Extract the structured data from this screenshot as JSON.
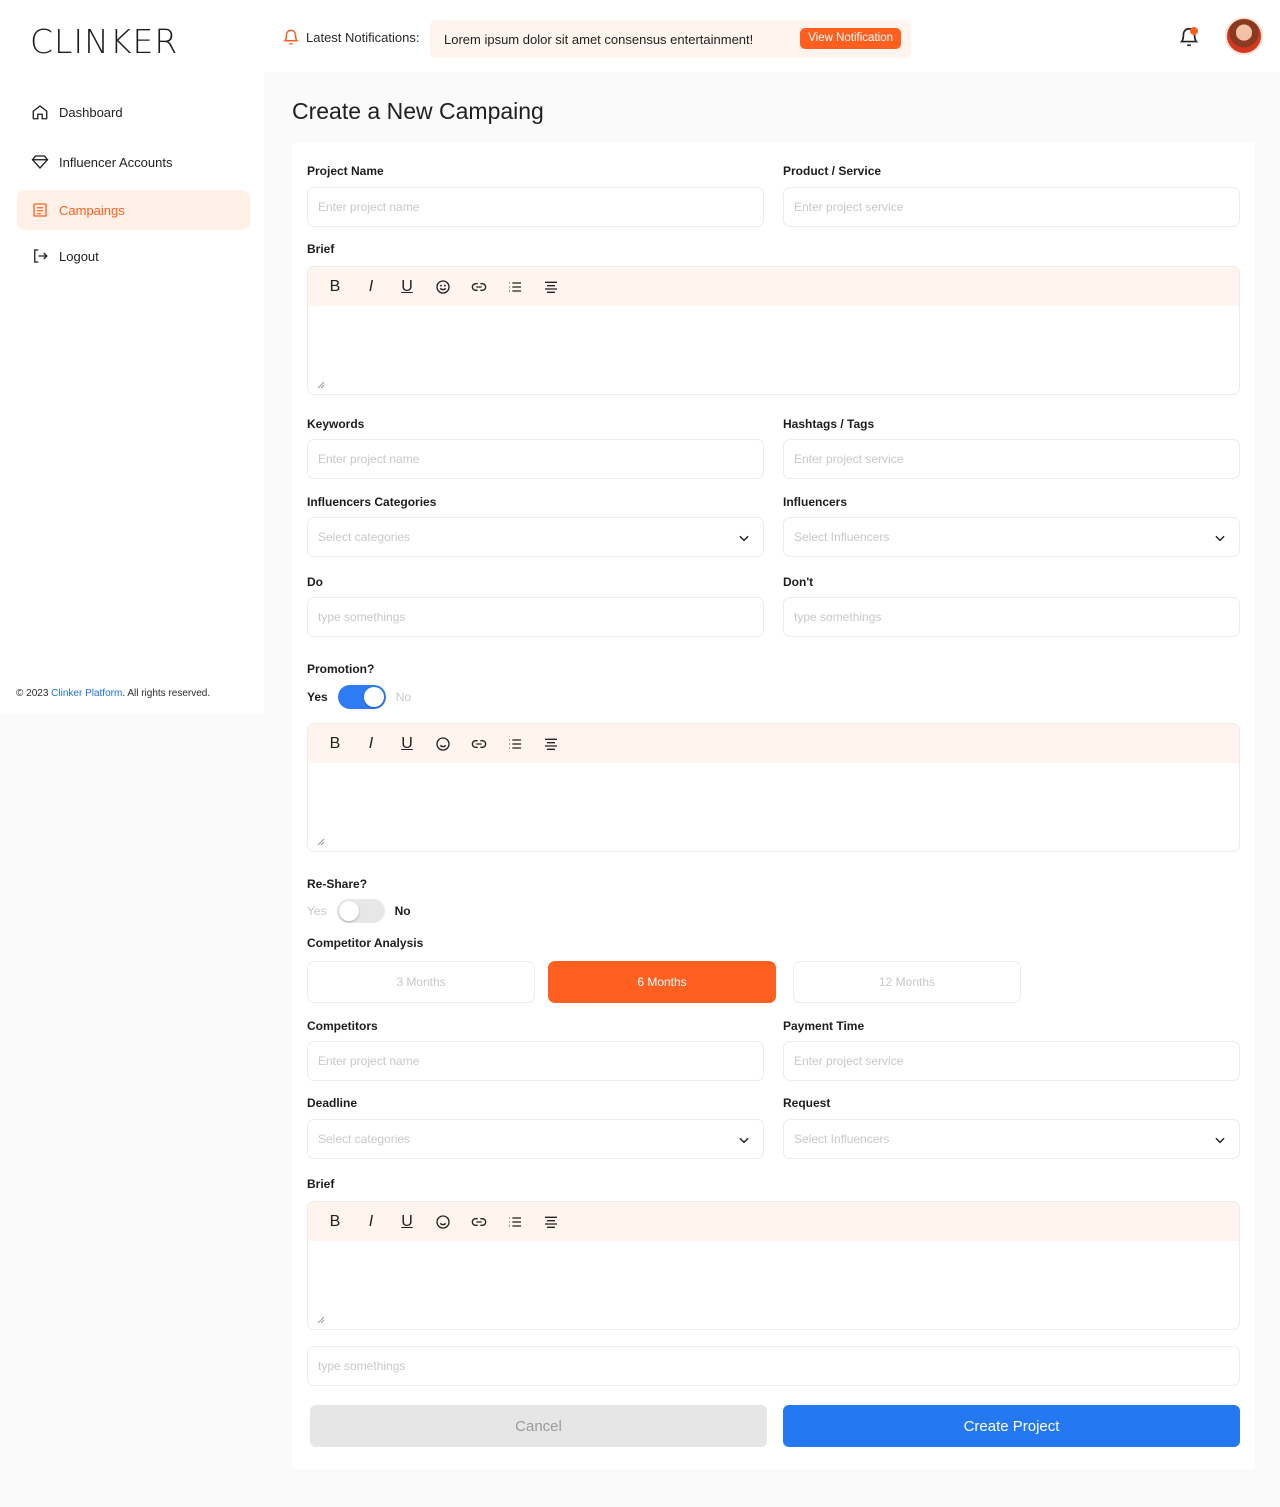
{
  "app": {
    "logo": "CLINKER"
  },
  "header": {
    "notifications_label": "Latest Notifications:",
    "notification_text": "Lorem ipsum dolor sit amet consensus entertainment!",
    "view_notification_label": "View Notification",
    "accent_color": "#ff5f1f"
  },
  "sidebar": {
    "items": [
      {
        "label": "Dashboard",
        "icon": "home-icon",
        "active": false
      },
      {
        "label": "Influencer Accounts",
        "icon": "diamond-icon",
        "active": false
      },
      {
        "label": "Campaings",
        "icon": "list-doc-icon",
        "active": true
      },
      {
        "label": "Logout",
        "icon": "logout-icon",
        "active": false
      }
    ],
    "copyright_prefix": "© 2023 ",
    "copyright_brand": "Clinker Platform",
    "copyright_suffix": ". All rights reserved."
  },
  "page": {
    "title": "Create a New Campaing"
  },
  "form": {
    "project_name": {
      "label": "Project Name",
      "placeholder": "Enter project name"
    },
    "product_service": {
      "label": "Product / Service",
      "placeholder": "Enter project service"
    },
    "brief_label": "Brief",
    "keywords": {
      "label": "Keywords",
      "placeholder": "Enter project name"
    },
    "hashtags": {
      "label": "Hashtags / Tags",
      "placeholder": "Enter project service"
    },
    "influencer_categories": {
      "label": "Influencers Categories",
      "placeholder": "Select categories"
    },
    "influencers": {
      "label": "Influencers",
      "placeholder": "Select Influencers"
    },
    "do": {
      "label": "Do",
      "placeholder": "type somethings"
    },
    "dont": {
      "label": "Don't",
      "placeholder": "type somethings"
    },
    "promotion": {
      "label": "Promotion?",
      "yes": "Yes",
      "no": "No",
      "value": "Yes"
    },
    "reshare": {
      "label": "Re-Share?",
      "yes": "Yes",
      "no": "No",
      "value": "No"
    },
    "competitor_analysis": {
      "label": "Competitor Analysis",
      "options": [
        "3 Months",
        "6 Months",
        "12 Months"
      ],
      "selected": "6 Months"
    },
    "competitors": {
      "label": "Competitors",
      "placeholder": "Enter project name"
    },
    "payment_time": {
      "label": "Payment Time",
      "placeholder": "Enter project service"
    },
    "deadline": {
      "label": "Deadline",
      "placeholder": "Select categories"
    },
    "request": {
      "label": "Request",
      "placeholder": "Select Influencers"
    },
    "brief2_label": "Brief",
    "extra": {
      "placeholder": "type somethings"
    },
    "toolbar": [
      "bold-icon",
      "italic-icon",
      "underline-icon",
      "emoji-icon",
      "link-icon",
      "list-icon",
      "align-center-icon"
    ],
    "cancel_label": "Cancel",
    "create_label": "Create Project",
    "primary_color": "#2479f3"
  }
}
